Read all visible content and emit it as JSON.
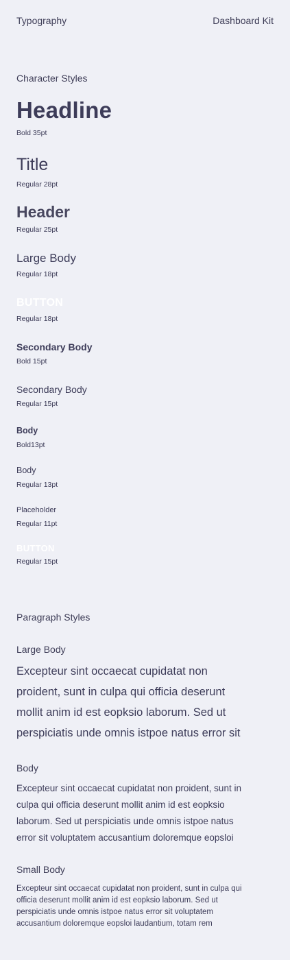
{
  "header": {
    "left": "Typography",
    "right": "Dashboard Kit"
  },
  "character_styles": {
    "title": "Character Styles",
    "items": [
      {
        "sample": "Headline",
        "spec": "Bold 35pt"
      },
      {
        "sample": "Title",
        "spec": "Regular 28pt"
      },
      {
        "sample": "Header",
        "spec": "Regular 25pt"
      },
      {
        "sample": "Large Body",
        "spec": "Regular 18pt"
      },
      {
        "sample": "BUTTON",
        "spec": "Regular 18pt"
      },
      {
        "sample": "Secondary Body",
        "spec": "Bold 15pt"
      },
      {
        "sample": "Secondary Body",
        "spec": "Regular 15pt"
      },
      {
        "sample": "Body",
        "spec": "Bold13pt"
      },
      {
        "sample": "Body",
        "spec": "Regular 13pt"
      },
      {
        "sample": "Placeholder",
        "spec": "Regular 11pt"
      },
      {
        "sample": "BUTTON",
        "spec": "Regular 15pt"
      }
    ]
  },
  "paragraph_styles": {
    "title": "Paragraph Styles",
    "items": [
      {
        "label": "Large Body",
        "text": "Excepteur sint occaecat cupidatat non proident, sunt in culpa qui officia deserunt mollit anim id est eopksio laborum. Sed ut perspiciatis unde omnis istpoe natus error sit"
      },
      {
        "label": "Body",
        "text": "Excepteur sint occaecat cupidatat non proident, sunt in culpa qui officia deserunt mollit anim id est eopksio laborum. Sed ut perspiciatis unde omnis istpoe natus error sit voluptatem accusantium doloremque eopsloi"
      },
      {
        "label": "Small Body",
        "text": "Excepteur sint occaecat cupidatat non proident, sunt in culpa qui officia deserunt mollit anim id est eopksio laborum. Sed ut perspiciatis unde omnis istpoe natus error sit voluptatem accusantium doloremque eopsloi laudantium, totam rem"
      }
    ]
  }
}
